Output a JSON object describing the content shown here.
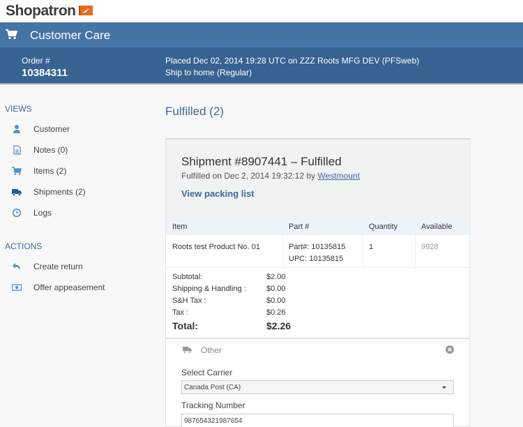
{
  "brand": {
    "name": "Shopatron",
    "flag_color": "#e86a1c"
  },
  "appbar": {
    "title": "Customer Care",
    "icon": "cart-icon",
    "color": "#4574a6"
  },
  "order": {
    "label": "Order #",
    "number": "10384311",
    "placed": "Placed Dec 02, 2014 19:28 UTC on  ZZZ Roots MFG DEV (PFSweb)",
    "ship_method": "Ship to home (Regular)"
  },
  "sidebar": {
    "views_label": "VIEWS",
    "views": [
      {
        "label": "Customer",
        "icon": "user-icon"
      },
      {
        "label": "Notes (0)",
        "icon": "document-icon"
      },
      {
        "label": "Items (2)",
        "icon": "cart-icon"
      },
      {
        "label": "Shipments (2)",
        "icon": "truck-icon"
      },
      {
        "label": "Logs",
        "icon": "clock-icon"
      }
    ],
    "actions_label": "ACTIONS",
    "actions": [
      {
        "label": "Create return",
        "icon": "reply-icon"
      },
      {
        "label": "Offer appeasement",
        "icon": "money-icon"
      }
    ]
  },
  "main": {
    "title": "Fulfilled (2)",
    "shipment": {
      "title": "Shipment #8907441 – Fulfilled",
      "fulfilled_prefix": "Fulfilled on Dec 2, 2014 19:32:12 by ",
      "fulfilled_by": "Westmount",
      "packing_link": "View packing list",
      "table": {
        "headers": [
          "Item",
          "Part #",
          "Quantity",
          "Available"
        ],
        "rows": [
          {
            "item": "Roots test Product No. 01",
            "part": "Part#: 10135815",
            "upc": "UPC: 10135815",
            "quantity": "1",
            "available": "9928"
          }
        ]
      },
      "totals": [
        {
          "label": "Subtotal:",
          "value": "$2.00"
        },
        {
          "label": "Shipping & Handling :",
          "value": "$0.00"
        },
        {
          "label": "S&H Tax :",
          "value": "$0.00"
        },
        {
          "label": "Tax :",
          "value": "$0.26"
        }
      ],
      "grand_total": {
        "label": "Total:",
        "value": "$2.26"
      },
      "carrier_section": {
        "label": "Other",
        "select_carrier_label": "Select Carrier",
        "carrier_value": "Canada Post (CA)",
        "tracking_label": "Tracking Number",
        "tracking_value": "987654321987654"
      }
    }
  }
}
